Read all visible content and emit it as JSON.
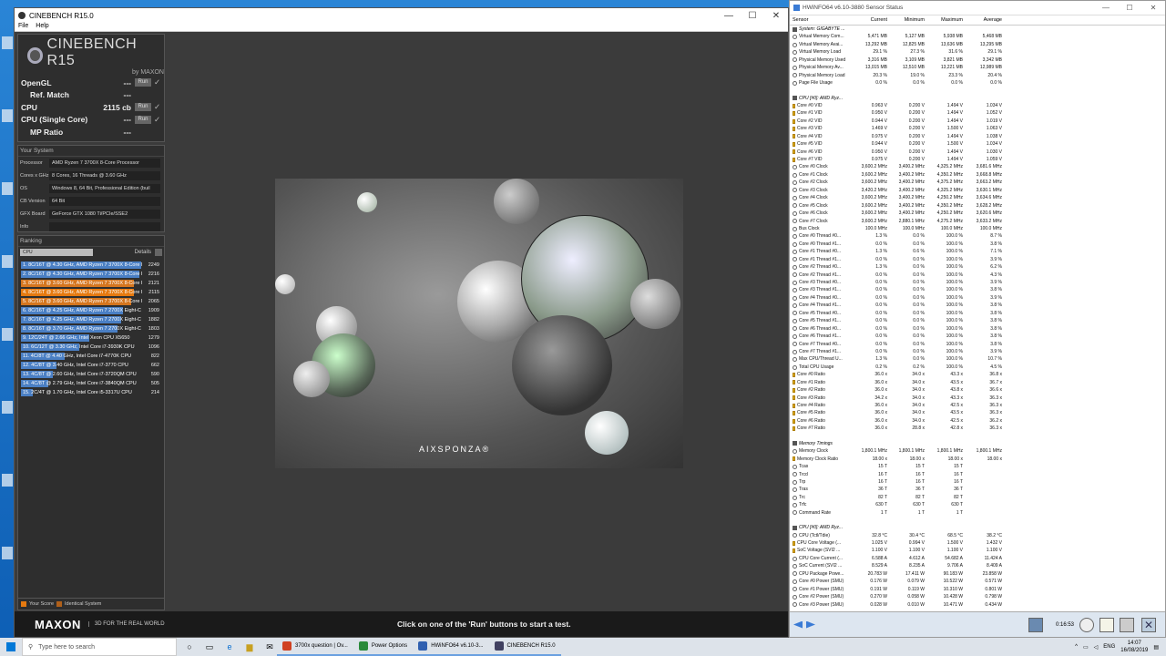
{
  "cinebench": {
    "title": "CINEBENCH R15.0",
    "menu": [
      "File",
      "Help"
    ],
    "logo_name": "CINEBENCH R15",
    "logo_by": "by MAXON",
    "tests": [
      {
        "label": "OpenGL",
        "value": "---",
        "run": "Run",
        "check": "✓"
      },
      {
        "label": "Ref. Match",
        "value": "---"
      },
      {
        "label": "CPU",
        "value": "2115 cb",
        "run": "Run",
        "check": "✓"
      },
      {
        "label": "CPU (Single Core)",
        "value": "---",
        "run": "Run",
        "check": "✓"
      },
      {
        "label": "MP Ratio",
        "value": "---"
      }
    ],
    "system_header": "Your System",
    "system": [
      {
        "key": "Processor",
        "value": "AMD Ryzen 7 3700X 8-Core Processor"
      },
      {
        "key": "Cores x GHz",
        "value": "8 Cores, 16 Threads @ 3.60 GHz"
      },
      {
        "key": "OS",
        "value": "Windows 8, 64 Bit, Professional Edition (buil"
      },
      {
        "key": "CB Version",
        "value": "64 Bit"
      },
      {
        "key": "GFX Board",
        "value": "GeForce GTX 1080 Ti/PCIe/SSE2"
      },
      {
        "key": "Info",
        "value": ""
      }
    ],
    "ranking_header": "Ranking",
    "ranking_select": "CPU",
    "ranking_details": "Details",
    "ranking": [
      {
        "label": "1. 8C/16T @ 4.30 GHz, AMD Ryzen 7 3700X 8-Core I",
        "score": "2249",
        "color": "#4a7fc4",
        "frac": 1.0
      },
      {
        "label": "2. 8C/16T @ 4.30 GHz, AMD Ryzen 7 3700X 8-Core I",
        "score": "2216",
        "color": "#4a7fc4",
        "frac": 0.985
      },
      {
        "label": "3. 8C/16T @ 3.60 GHz, AMD Ryzen 7 3700X 8-Core I",
        "score": "2121",
        "color": "#d5761f",
        "frac": 0.943
      },
      {
        "label": "4. 8C/16T @ 3.60 GHz, AMD Ryzen 7 3700X 8-Core I",
        "score": "2115",
        "color": "#e67a10",
        "frac": 0.94
      },
      {
        "label": "5. 8C/16T @ 3.60 GHz, AMD Ryzen 7 3700X 8-Core I",
        "score": "2065",
        "color": "#d5761f",
        "frac": 0.918
      },
      {
        "label": "6. 8C/16T @ 4.25 GHz, AMD Ryzen 7 2700X Eight-C",
        "score": "1909",
        "color": "#4a7fc4",
        "frac": 0.849
      },
      {
        "label": "7. 8C/16T @ 4.25 GHz, AMD Ryzen 7 2700X Eight-C",
        "score": "1882",
        "color": "#4a7fc4",
        "frac": 0.837
      },
      {
        "label": "8. 8C/16T @ 3.70 GHz, AMD Ryzen 7 2700X Eight-C",
        "score": "1803",
        "color": "#4a7fc4",
        "frac": 0.802
      },
      {
        "label": "9. 12C/24T @ 2.66 GHz, Intel Xeon CPU X5650",
        "score": "1279",
        "color": "#4a7fc4",
        "frac": 0.569
      },
      {
        "label": "10. 6C/12T @ 3.30 GHz,  Intel Core i7-3930K CPU",
        "score": "1096",
        "color": "#4a7fc4",
        "frac": 0.487
      },
      {
        "label": "11. 4C/8T @ 4.40 GHz, Intel Core i7-4770K CPU",
        "score": "822",
        "color": "#4a7fc4",
        "frac": 0.365
      },
      {
        "label": "12. 4C/8T @ 3.40 GHz,  Intel Core i7-3770 CPU",
        "score": "662",
        "color": "#4a7fc4",
        "frac": 0.294
      },
      {
        "label": "13. 4C/8T @ 2.60 GHz, Intel Core i7-3720QM CPU",
        "score": "590",
        "color": "#4a7fc4",
        "frac": 0.262
      },
      {
        "label": "14. 4C/8T @ 2.79 GHz,  Intel Core i7-3840QM CPU",
        "score": "505",
        "color": "#4a7fc4",
        "frac": 0.225
      },
      {
        "label": "15. 2C/4T @ 1.70 GHz,  Intel Core i5-3317U CPU",
        "score": "214",
        "color": "#4a7fc4",
        "frac": 0.095
      }
    ],
    "legend_your": "Your Score",
    "legend_identical": "Identical System",
    "footer_logo": "MAXON",
    "footer_tag": "3D FOR THE REAL WORLD",
    "footer_hint": "Click on one of the 'Run' buttons to start a test.",
    "render_brand": "AIXSPONZA®"
  },
  "hwinfo": {
    "title": "HWiNFO64 v6.10-3880 Sensor Status",
    "columns": [
      "Sensor",
      "Current",
      "Minimum",
      "Maximum",
      "Average"
    ],
    "groups": [
      {
        "name": "System: GIGABYTE ...",
        "rows": [
          [
            "Virtual Memory Com...",
            "5,471 MB",
            "5,127 MB",
            "5,938 MB",
            "5,468 MB"
          ],
          [
            "Virtual Memory Avai...",
            "13,292 MB",
            "12,825 MB",
            "13,636 MB",
            "13,295 MB"
          ],
          [
            "Virtual Memory Load",
            "29.1 %",
            "27.3 %",
            "31.6 %",
            "29.1 %"
          ],
          [
            "Physical Memory Used",
            "3,316 MB",
            "3,109 MB",
            "3,821 MB",
            "3,342 MB"
          ],
          [
            "Physical Memory Av...",
            "13,015 MB",
            "12,510 MB",
            "13,221 MB",
            "12,989 MB"
          ],
          [
            "Physical Memory Load",
            "20.3 %",
            "19.0 %",
            "23.3 %",
            "20.4 %"
          ],
          [
            "Page File Usage",
            "0.0 %",
            "0.0 %",
            "0.0 %",
            "0.0 %"
          ]
        ]
      },
      {
        "name": "CPU [#0]: AMD Ryz...",
        "rows": [
          [
            "Core #0 VID",
            "0.963 V",
            "0.200 V",
            "1.494 V",
            "1.034 V"
          ],
          [
            "Core #1 VID",
            "0.950 V",
            "0.200 V",
            "1.494 V",
            "1.052 V"
          ],
          [
            "Core #2 VID",
            "0.944 V",
            "0.200 V",
            "1.494 V",
            "1.019 V"
          ],
          [
            "Core #3 VID",
            "1.469 V",
            "0.200 V",
            "1.500 V",
            "1.063 V"
          ],
          [
            "Core #4 VID",
            "0.975 V",
            "0.200 V",
            "1.494 V",
            "1.038 V"
          ],
          [
            "Core #5 VID",
            "0.944 V",
            "0.200 V",
            "1.500 V",
            "1.034 V"
          ],
          [
            "Core #6 VID",
            "0.950 V",
            "0.200 V",
            "1.494 V",
            "1.030 V"
          ],
          [
            "Core #7 VID",
            "0.975 V",
            "0.200 V",
            "1.494 V",
            "1.059 V"
          ],
          [
            "Core #0 Clock",
            "3,600.2 MHz",
            "3,400.2 MHz",
            "4,325.2 MHz",
            "3,681.6 MHz"
          ],
          [
            "Core #1 Clock",
            "3,600.2 MHz",
            "3,400.2 MHz",
            "4,350.2 MHz",
            "3,668.8 MHz"
          ],
          [
            "Core #2 Clock",
            "3,600.2 MHz",
            "3,400.2 MHz",
            "4,375.2 MHz",
            "3,663.2 MHz"
          ],
          [
            "Core #3 Clock",
            "3,420.2 MHz",
            "3,400.2 MHz",
            "4,325.2 MHz",
            "3,630.1 MHz"
          ],
          [
            "Core #4 Clock",
            "3,600.2 MHz",
            "3,400.2 MHz",
            "4,250.2 MHz",
            "3,634.6 MHz"
          ],
          [
            "Core #5 Clock",
            "3,600.2 MHz",
            "3,400.2 MHz",
            "4,350.2 MHz",
            "3,628.2 MHz"
          ],
          [
            "Core #6 Clock",
            "3,600.2 MHz",
            "3,400.2 MHz",
            "4,250.2 MHz",
            "3,620.6 MHz"
          ],
          [
            "Core #7 Clock",
            "3,600.2 MHz",
            "2,880.1 MHz",
            "4,275.2 MHz",
            "3,633.2 MHz"
          ],
          [
            "Bus Clock",
            "100.0 MHz",
            "100.0 MHz",
            "100.0 MHz",
            "100.0 MHz"
          ],
          [
            "Core #0 Thread #0...",
            "1.3 %",
            "0.0 %",
            "100.0 %",
            "8.7 %"
          ],
          [
            "Core #0 Thread #1...",
            "0.0 %",
            "0.0 %",
            "100.0 %",
            "3.8 %"
          ],
          [
            "Core #1 Thread #0...",
            "1.3 %",
            "0.6 %",
            "100.0 %",
            "7.1 %"
          ],
          [
            "Core #1 Thread #1...",
            "0.0 %",
            "0.0 %",
            "100.0 %",
            "3.9 %"
          ],
          [
            "Core #2 Thread #0...",
            "1.3 %",
            "0.0 %",
            "100.0 %",
            "6.2 %"
          ],
          [
            "Core #2 Thread #1...",
            "0.0 %",
            "0.0 %",
            "100.0 %",
            "4.3 %"
          ],
          [
            "Core #3 Thread #0...",
            "0.0 %",
            "0.0 %",
            "100.0 %",
            "3.9 %"
          ],
          [
            "Core #3 Thread #1...",
            "0.0 %",
            "0.0 %",
            "100.0 %",
            "3.8 %"
          ],
          [
            "Core #4 Thread #0...",
            "0.0 %",
            "0.0 %",
            "100.0 %",
            "3.9 %"
          ],
          [
            "Core #4 Thread #1...",
            "0.0 %",
            "0.0 %",
            "100.0 %",
            "3.8 %"
          ],
          [
            "Core #5 Thread #0...",
            "0.0 %",
            "0.0 %",
            "100.0 %",
            "3.8 %"
          ],
          [
            "Core #5 Thread #1...",
            "0.0 %",
            "0.0 %",
            "100.0 %",
            "3.8 %"
          ],
          [
            "Core #6 Thread #0...",
            "0.0 %",
            "0.0 %",
            "100.0 %",
            "3.8 %"
          ],
          [
            "Core #6 Thread #1...",
            "0.0 %",
            "0.0 %",
            "100.0 %",
            "3.8 %"
          ],
          [
            "Core #7 Thread #0...",
            "0.0 %",
            "0.0 %",
            "100.0 %",
            "3.8 %"
          ],
          [
            "Core #7 Thread #1...",
            "0.0 %",
            "0.0 %",
            "100.0 %",
            "3.9 %"
          ],
          [
            "Max CPU/Thread U...",
            "1.3 %",
            "0.0 %",
            "100.0 %",
            "10.7 %"
          ],
          [
            "Total CPU Usage",
            "0.2 %",
            "0.2 %",
            "100.0 %",
            "4.5 %"
          ],
          [
            "Core #0 Ratio",
            "36.0 x",
            "34.0 x",
            "43.3 x",
            "36.8 x"
          ],
          [
            "Core #1 Ratio",
            "36.0 x",
            "34.0 x",
            "43.5 x",
            "36.7 x"
          ],
          [
            "Core #2 Ratio",
            "36.0 x",
            "34.0 x",
            "43.8 x",
            "36.6 x"
          ],
          [
            "Core #3 Ratio",
            "34.2 x",
            "34.0 x",
            "43.3 x",
            "36.3 x"
          ],
          [
            "Core #4 Ratio",
            "36.0 x",
            "34.0 x",
            "42.5 x",
            "36.3 x"
          ],
          [
            "Core #5 Ratio",
            "36.0 x",
            "34.0 x",
            "43.5 x",
            "36.3 x"
          ],
          [
            "Core #6 Ratio",
            "36.0 x",
            "34.0 x",
            "42.5 x",
            "36.2 x"
          ],
          [
            "Core #7 Ratio",
            "36.0 x",
            "28.8 x",
            "42.8 x",
            "36.3 x"
          ]
        ]
      },
      {
        "name": "Memory Timings",
        "rows": [
          [
            "Memory Clock",
            "1,800.1 MHz",
            "1,800.1 MHz",
            "1,800.1 MHz",
            "1,800.1 MHz"
          ],
          [
            "Memory Clock Ratio",
            "18.00 x",
            "18.00 x",
            "18.00 x",
            "18.00 x"
          ],
          [
            "Tcas",
            "15 T",
            "15 T",
            "15 T",
            ""
          ],
          [
            "Trcd",
            "16 T",
            "16 T",
            "16 T",
            ""
          ],
          [
            "Trp",
            "16 T",
            "16 T",
            "16 T",
            ""
          ],
          [
            "Tras",
            "36 T",
            "36 T",
            "36 T",
            ""
          ],
          [
            "Trc",
            "82 T",
            "82 T",
            "82 T",
            ""
          ],
          [
            "Trfc",
            "630 T",
            "630 T",
            "630 T",
            ""
          ],
          [
            "Command Rate",
            "1 T",
            "1 T",
            "1 T",
            ""
          ]
        ]
      },
      {
        "name": "CPU [#0]: AMD Ryz...",
        "rows": [
          [
            "CPU (Tctl/Tdie)",
            "32.8 °C",
            "30.4 °C",
            "68.5 °C",
            "38.2 °C"
          ],
          [
            "CPU Core Voltage (...",
            "1.025 V",
            "0.994 V",
            "1.500 V",
            "1.432 V"
          ],
          [
            "SoC Voltage (SVI2 ...",
            "1.100 V",
            "1.100 V",
            "1.100 V",
            "1.100 V"
          ],
          [
            "CPU Core Current (...",
            "6.588 A",
            "4.612 A",
            "54.682 A",
            "11.424 A"
          ],
          [
            "SoC Current (SVI2 ...",
            "8.529 A",
            "8.235 A",
            "9.706 A",
            "8.409 A"
          ],
          [
            "CPU Package Powe...",
            "20.783 W",
            "17.411 W",
            "90.183 W",
            "23.858 W"
          ],
          [
            "Core #0 Power (SMU)",
            "0.176 W",
            "0.079 W",
            "10.522 W",
            "0.571 W"
          ],
          [
            "Core #1 Power (SMU)",
            "0.191 W",
            "0.119 W",
            "10.310 W",
            "0.801 W"
          ],
          [
            "Core #2 Power (SMU)",
            "0.270 W",
            "0.058 W",
            "10.428 W",
            "0.798 W"
          ],
          [
            "Core #3 Power (SMU)",
            "0.028 W",
            "0.010 W",
            "10.471 W",
            "0.434 W"
          ]
        ]
      }
    ],
    "timer": "0:16:53"
  },
  "taskbar": {
    "search_placeholder": "Type here to search",
    "apps": [
      {
        "label": "3700x question | Ov...",
        "color": "#d04020"
      },
      {
        "label": "Power Options",
        "color": "#2a8a3a"
      },
      {
        "label": "HWiNFO64 v6.10-3...",
        "color": "#3060b0"
      },
      {
        "label": "CINEBENCH R15.0",
        "color": "#404060"
      }
    ],
    "lang": "ENG",
    "time": "14:07",
    "date": "16/08/2019"
  }
}
